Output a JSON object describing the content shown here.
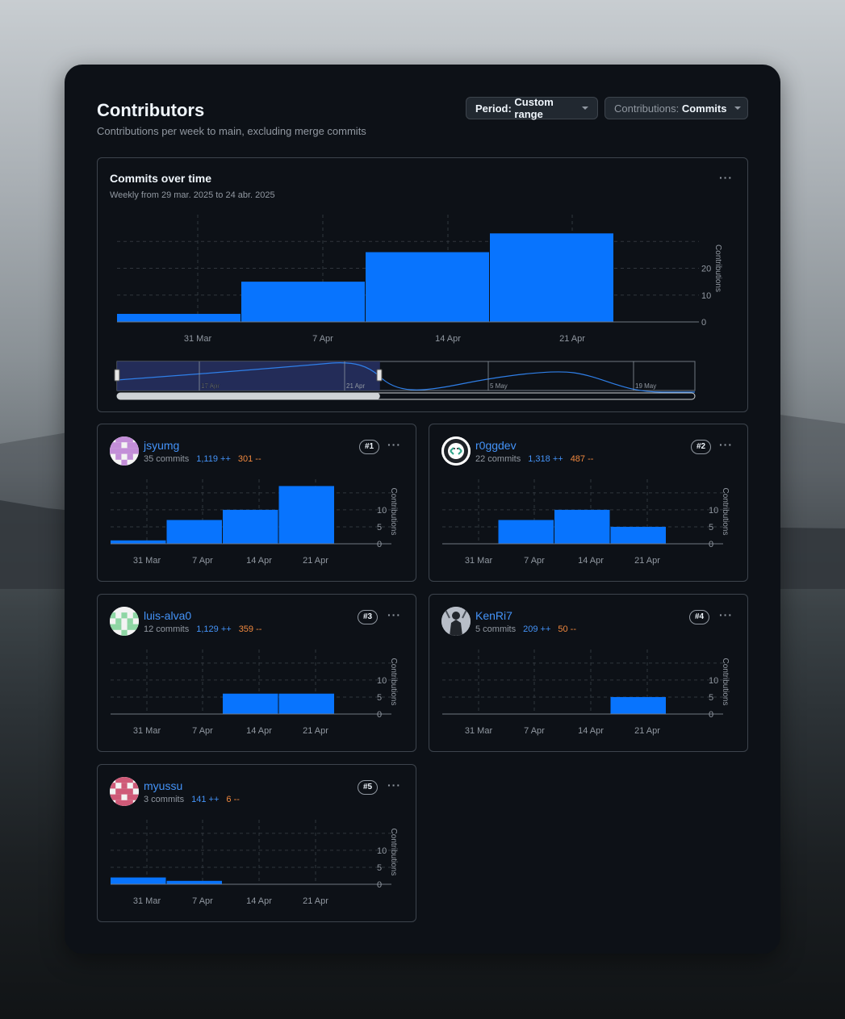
{
  "header": {
    "title": "Contributors",
    "subtitle": "Contributions per week to main, excluding merge commits",
    "period_key": "Period:",
    "period_value": "Custom range",
    "contrib_key": "Contributions:",
    "contrib_value": "Commits"
  },
  "icons": {
    "more": "kebab-horizontal-icon",
    "dropdown": "triangle-down-icon"
  },
  "colors": {
    "bar": "#0874fe",
    "addition": "#4493f8",
    "deletion": "#f0883e"
  },
  "main_chart": {
    "title": "Commits over time",
    "subtitle": "Weekly from 29 mar. 2025 to 24 abr. 2025",
    "more": "···"
  },
  "range_selector": {
    "labels": [
      "17 Apr",
      "21 Apr",
      "5 May",
      "19 May"
    ],
    "selection": [
      0,
      0.455
    ]
  },
  "chart_data": [
    {
      "type": "bar",
      "title": "Commits over time",
      "categories": [
        "31 Mar",
        "7 Apr",
        "14 Apr",
        "21 Apr"
      ],
      "values": [
        3,
        15,
        26,
        33
      ],
      "ylabel": "Contributions",
      "yticks": [
        0,
        10,
        20
      ],
      "ylim": [
        0,
        40
      ],
      "grid": true
    },
    {
      "type": "bar",
      "title": "jsyumg",
      "categories": [
        "31 Mar",
        "7 Apr",
        "14 Apr",
        "21 Apr"
      ],
      "values": [
        1,
        7,
        10,
        17
      ],
      "ylabel": "Contributions",
      "yticks": [
        0,
        5,
        10
      ],
      "ylim": [
        0,
        19
      ],
      "grid": true
    },
    {
      "type": "bar",
      "title": "r0ggdev",
      "categories": [
        "31 Mar",
        "7 Apr",
        "14 Apr",
        "21 Apr"
      ],
      "values": [
        0,
        7,
        10,
        5
      ],
      "ylabel": "Contributions",
      "yticks": [
        0,
        5,
        10
      ],
      "ylim": [
        0,
        19
      ],
      "grid": true
    },
    {
      "type": "bar",
      "title": "luis-alva0",
      "categories": [
        "31 Mar",
        "7 Apr",
        "14 Apr",
        "21 Apr"
      ],
      "values": [
        0,
        0,
        6,
        6
      ],
      "ylabel": "Contributions",
      "yticks": [
        0,
        5,
        10
      ],
      "ylim": [
        0,
        19
      ],
      "grid": true
    },
    {
      "type": "bar",
      "title": "KenRi7",
      "categories": [
        "31 Mar",
        "7 Apr",
        "14 Apr",
        "21 Apr"
      ],
      "values": [
        0,
        0,
        0,
        5
      ],
      "ylabel": "Contributions",
      "yticks": [
        0,
        5,
        10
      ],
      "ylim": [
        0,
        19
      ],
      "grid": true
    },
    {
      "type": "bar",
      "title": "myussu",
      "categories": [
        "31 Mar",
        "7 Apr",
        "14 Apr",
        "21 Apr"
      ],
      "values": [
        2,
        1,
        0,
        0
      ],
      "ylabel": "Contributions",
      "yticks": [
        0,
        5,
        10
      ],
      "ylim": [
        0,
        19
      ],
      "grid": true
    }
  ],
  "contributors": [
    {
      "name": "jsyumg",
      "commits": "35 commits",
      "additions": "1,119 ++",
      "deletions": "301 --",
      "rank": "#1",
      "more": "···"
    },
    {
      "name": "r0ggdev",
      "commits": "22 commits",
      "additions": "1,318 ++",
      "deletions": "487 --",
      "rank": "#2",
      "more": "···"
    },
    {
      "name": "luis-alva0",
      "commits": "12 commits",
      "additions": "1,129 ++",
      "deletions": "359 --",
      "rank": "#3",
      "more": "···"
    },
    {
      "name": "KenRi7",
      "commits": "5 commits",
      "additions": "209 ++",
      "deletions": "50 --",
      "rank": "#4",
      "more": "···"
    },
    {
      "name": "myussu",
      "commits": "3 commits",
      "additions": "141 ++",
      "deletions": "6 --",
      "rank": "#5",
      "more": "···"
    }
  ]
}
